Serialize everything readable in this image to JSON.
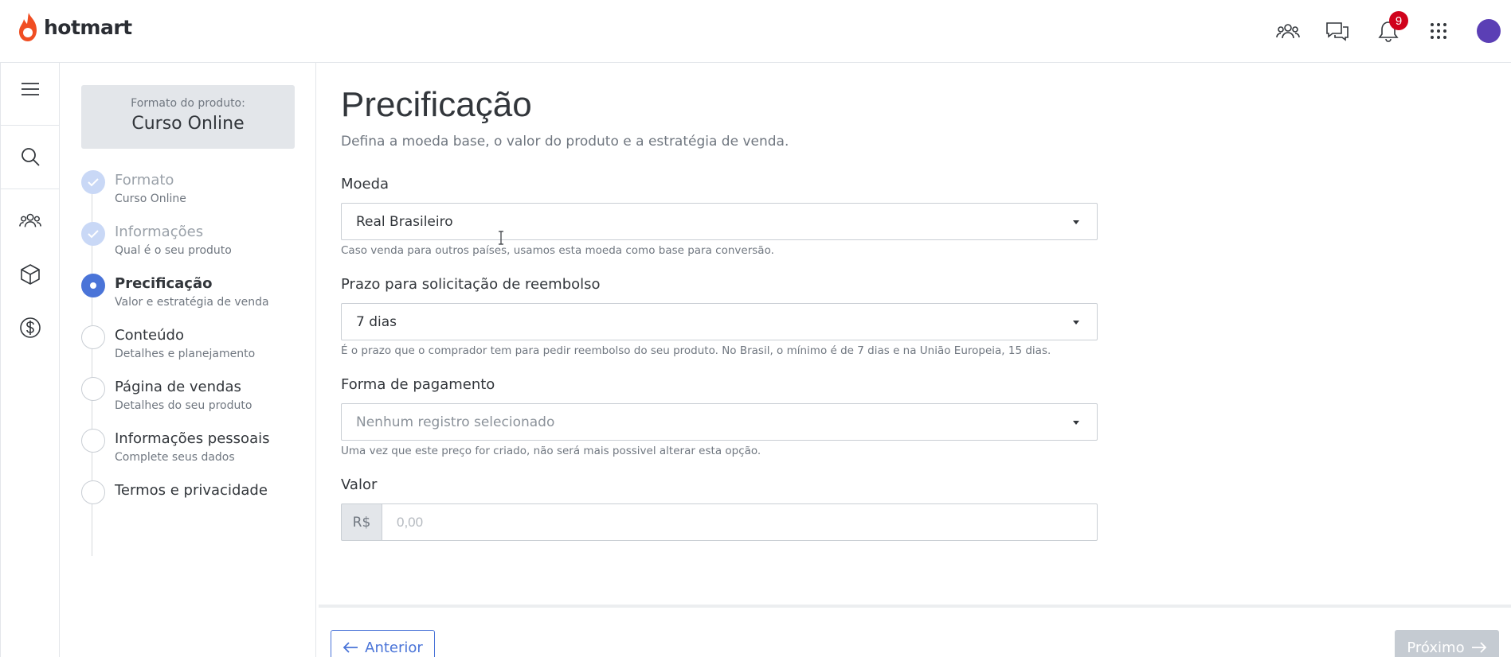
{
  "app": {
    "brand": "hotmart",
    "brand_color": "#f04e23",
    "accent_color": "#4a74d8"
  },
  "header": {
    "icons": [
      "people-icon",
      "chat-icon",
      "bell-icon",
      "apps-grid-icon",
      "avatar"
    ],
    "notifications_count": "9"
  },
  "rail": {
    "items": [
      "menu-icon",
      "search-icon",
      "people-icon",
      "box-icon",
      "dollar-icon"
    ]
  },
  "product_format": {
    "label": "Formato do produto:",
    "value": "Curso Online"
  },
  "steps": [
    {
      "title": "Formato",
      "subtitle": "Curso Online",
      "state": "done"
    },
    {
      "title": "Informações",
      "subtitle": "Qual é o seu produto",
      "state": "done"
    },
    {
      "title": "Precificação",
      "subtitle": "Valor e estratégia de venda",
      "state": "active"
    },
    {
      "title": "Conteúdo",
      "subtitle": "Detalhes e planejamento",
      "state": "pending"
    },
    {
      "title": "Página de vendas",
      "subtitle": "Detalhes do seu produto",
      "state": "pending"
    },
    {
      "title": "Informações pessoais",
      "subtitle": "Complete seus dados",
      "state": "pending"
    },
    {
      "title": "Termos e privacidade",
      "subtitle": "",
      "state": "pending"
    }
  ],
  "form": {
    "title": "Precificação",
    "description": "Defina a moeda base, o valor do produto e a estratégia de venda.",
    "currency": {
      "label": "Moeda",
      "value": "Real Brasileiro",
      "help": "Caso venda para outros países, usamos esta moeda como base para conversão."
    },
    "refund": {
      "label": "Prazo para solicitação de reembolso",
      "value": "7 dias",
      "help": "É o prazo que o comprador tem para pedir reembolso do seu produto. No Brasil, o mínimo é de 7 dias e na União Europeia, 15 dias."
    },
    "payment": {
      "label": "Forma de pagamento",
      "placeholder": "Nenhum registro selecionado",
      "help": "Uma vez que este preço for criado, não será mais possivel alterar esta opção."
    },
    "price": {
      "label": "Valor",
      "prefix": "R$",
      "placeholder": "0,00"
    }
  },
  "footer": {
    "prev_label": "Anterior",
    "next_label": "Próximo"
  }
}
